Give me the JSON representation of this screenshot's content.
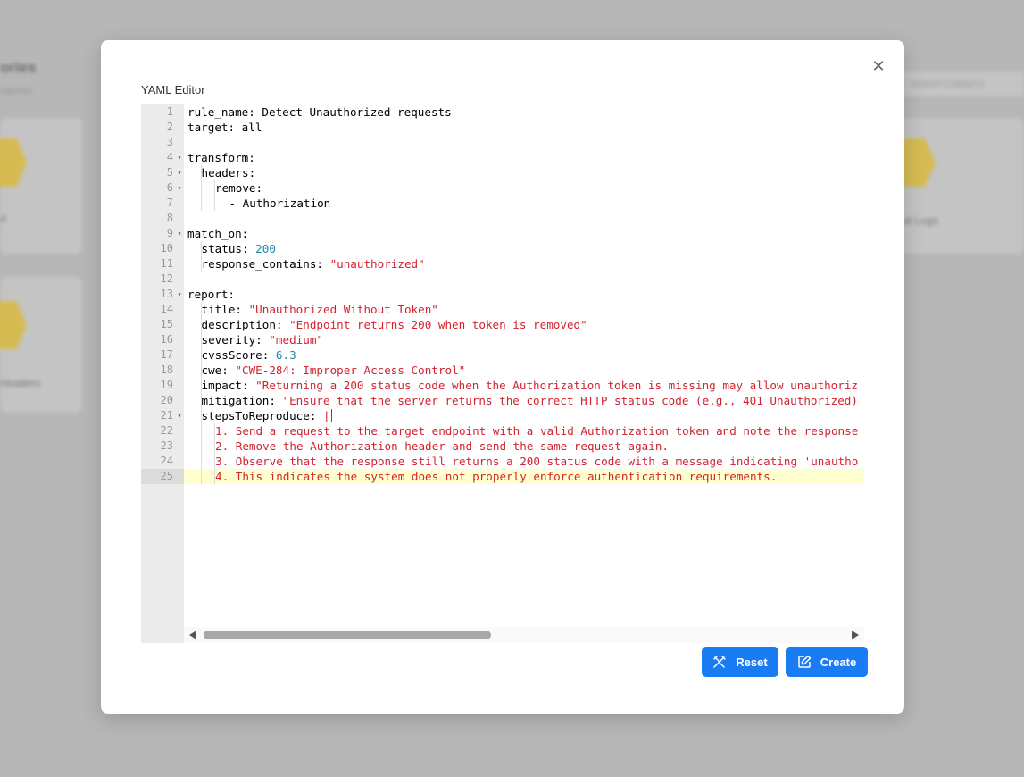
{
  "background": {
    "title": "ories",
    "subtitle": "egories",
    "search_placeholder": "Search Category",
    "labels": [
      "d",
      "al Logs",
      "Headers"
    ]
  },
  "modal": {
    "title": "YAML Editor",
    "close_icon": "close-icon"
  },
  "editor": {
    "lines": [
      {
        "n": "1",
        "fold": "",
        "indent": 0,
        "segs": [
          [
            "k",
            "rule_name: Detect Unauthorized requests"
          ]
        ]
      },
      {
        "n": "2",
        "fold": "",
        "indent": 0,
        "segs": [
          [
            "k",
            "target: all"
          ]
        ]
      },
      {
        "n": "3",
        "fold": "",
        "indent": 0,
        "segs": []
      },
      {
        "n": "4",
        "fold": "▾",
        "indent": 0,
        "segs": [
          [
            "k",
            "transform:"
          ]
        ]
      },
      {
        "n": "5",
        "fold": "▾",
        "indent": 1,
        "segs": [
          [
            "k",
            "headers:"
          ]
        ]
      },
      {
        "n": "6",
        "fold": "▾",
        "indent": 2,
        "segs": [
          [
            "k",
            "remove:"
          ]
        ]
      },
      {
        "n": "7",
        "fold": "",
        "indent": 3,
        "segs": [
          [
            "k",
            "- Authorization"
          ]
        ]
      },
      {
        "n": "8",
        "fold": "",
        "indent": 0,
        "segs": []
      },
      {
        "n": "9",
        "fold": "▾",
        "indent": 0,
        "segs": [
          [
            "k",
            "match_on:"
          ]
        ]
      },
      {
        "n": "10",
        "fold": "",
        "indent": 1,
        "segs": [
          [
            "k",
            "status: "
          ],
          [
            "num",
            "200"
          ]
        ]
      },
      {
        "n": "11",
        "fold": "",
        "indent": 1,
        "segs": [
          [
            "k",
            "response_contains: "
          ],
          [
            "str",
            "\"unauthorized\""
          ]
        ]
      },
      {
        "n": "12",
        "fold": "",
        "indent": 0,
        "segs": []
      },
      {
        "n": "13",
        "fold": "▾",
        "indent": 0,
        "segs": [
          [
            "k",
            "report:"
          ]
        ]
      },
      {
        "n": "14",
        "fold": "",
        "indent": 1,
        "segs": [
          [
            "k",
            "title: "
          ],
          [
            "str",
            "\"Unauthorized Without Token\""
          ]
        ]
      },
      {
        "n": "15",
        "fold": "",
        "indent": 1,
        "segs": [
          [
            "k",
            "description: "
          ],
          [
            "str",
            "\"Endpoint returns 200 when token is removed\""
          ]
        ]
      },
      {
        "n": "16",
        "fold": "",
        "indent": 1,
        "segs": [
          [
            "k",
            "severity: "
          ],
          [
            "str",
            "\"medium\""
          ]
        ]
      },
      {
        "n": "17",
        "fold": "",
        "indent": 1,
        "segs": [
          [
            "k",
            "cvssScore: "
          ],
          [
            "num",
            "6.3"
          ]
        ]
      },
      {
        "n": "18",
        "fold": "",
        "indent": 1,
        "segs": [
          [
            "k",
            "cwe: "
          ],
          [
            "str",
            "\"CWE-284: Improper Access Control\""
          ]
        ]
      },
      {
        "n": "19",
        "fold": "",
        "indent": 1,
        "segs": [
          [
            "k",
            "impact: "
          ],
          [
            "str",
            "\"Returning a 200 status code when the Authorization token is missing may allow unauthoriz"
          ]
        ]
      },
      {
        "n": "20",
        "fold": "",
        "indent": 1,
        "segs": [
          [
            "k",
            "mitigation: "
          ],
          [
            "str",
            "\"Ensure that the server returns the correct HTTP status code (e.g., 401 Unauthorized)"
          ]
        ]
      },
      {
        "n": "21",
        "fold": "▾",
        "indent": 1,
        "segs": [
          [
            "k",
            "stepsToReproduce: "
          ],
          [
            "str",
            "|"
          ]
        ]
      },
      {
        "n": "22",
        "fold": "",
        "indent": 2,
        "segs": [
          [
            "str",
            "1. Send a request to the target endpoint with a valid Authorization token and note the response"
          ]
        ]
      },
      {
        "n": "23",
        "fold": "",
        "indent": 2,
        "segs": [
          [
            "str",
            "2. Remove the Authorization header and send the same request again."
          ]
        ]
      },
      {
        "n": "24",
        "fold": "",
        "indent": 2,
        "segs": [
          [
            "str",
            "3. Observe that the response still returns a 200 status code with a message indicating 'unautho"
          ]
        ]
      },
      {
        "n": "25",
        "fold": "",
        "indent": 2,
        "active": true,
        "segs": [
          [
            "str",
            "4. This indicates the system does not properly enforce authentication requirements."
          ]
        ]
      }
    ]
  },
  "buttons": {
    "reset_label": "Reset",
    "create_label": "Create",
    "reset_icon": "tools-icon",
    "create_icon": "edit-icon",
    "color": "#1a7cf5"
  }
}
